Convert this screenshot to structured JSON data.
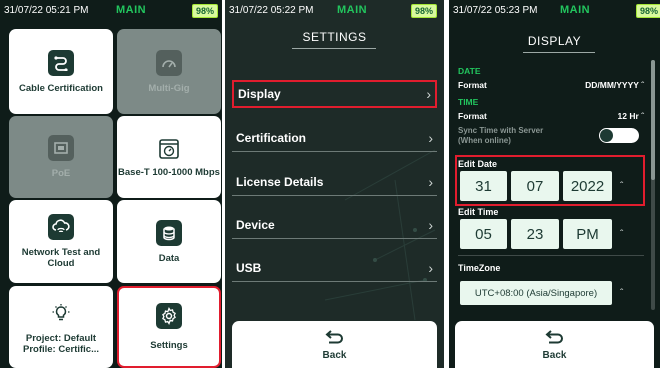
{
  "colors": {
    "accent": "#22c55e",
    "highlight": "#e11d2e",
    "background": "#0f1c19"
  },
  "screen1": {
    "status": {
      "time": "31/07/22 05:21 PM",
      "mode": "MAIN",
      "battery": "98%"
    },
    "tiles": [
      {
        "label": "Cable Certification",
        "icon": "cable-icon",
        "state": "enabled"
      },
      {
        "label": "Multi-Gig",
        "icon": "speedometer-icon",
        "state": "disabled"
      },
      {
        "label": "PoE",
        "icon": "ethernet-port-icon",
        "state": "disabled"
      },
      {
        "label": "Base-T 100-1000 Mbps",
        "icon": "stopwatch-icon",
        "state": "enabled"
      },
      {
        "label": "Network Test and Cloud",
        "icon": "cloud-network-icon",
        "state": "enabled"
      },
      {
        "label": "Data",
        "icon": "database-icon",
        "state": "enabled"
      },
      {
        "label": "Project: Default Profile: Certific...",
        "icon": "lightbulb-icon",
        "state": "enabled"
      },
      {
        "label": "Settings",
        "icon": "gear-icon",
        "state": "selected"
      }
    ]
  },
  "screen2": {
    "status": {
      "time": "31/07/22 05:22 PM",
      "mode": "MAIN",
      "battery": "98%"
    },
    "title": "SETTINGS",
    "items": [
      {
        "label": "Display",
        "selected": true
      },
      {
        "label": "Certification",
        "selected": false
      },
      {
        "label": "License Details",
        "selected": false
      },
      {
        "label": "Device",
        "selected": false
      },
      {
        "label": "USB",
        "selected": false
      }
    ],
    "back_label": "Back"
  },
  "screen3": {
    "status": {
      "time": "31/07/22 05:23 PM",
      "mode": "MAIN",
      "battery": "98%"
    },
    "title": "DISPLAY",
    "date_section": "DATE",
    "date_format_label": "Format",
    "date_format_value": "DD/MM/YYYY",
    "time_section": "TIME",
    "time_format_label": "Format",
    "time_format_value": "12 Hr",
    "sync_label_line1": "Sync Time with Server",
    "sync_label_line2": "(When online)",
    "sync_enabled": false,
    "edit_date_label": "Edit Date",
    "edit_date": {
      "day": "31",
      "month": "07",
      "year": "2022"
    },
    "edit_time_label": "Edit Time",
    "edit_time": {
      "hour": "05",
      "minute": "23",
      "ampm": "PM"
    },
    "timezone_label": "TimeZone",
    "timezone_value": "UTC+08:00 (Asia/Singapore)",
    "back_label": "Back"
  }
}
